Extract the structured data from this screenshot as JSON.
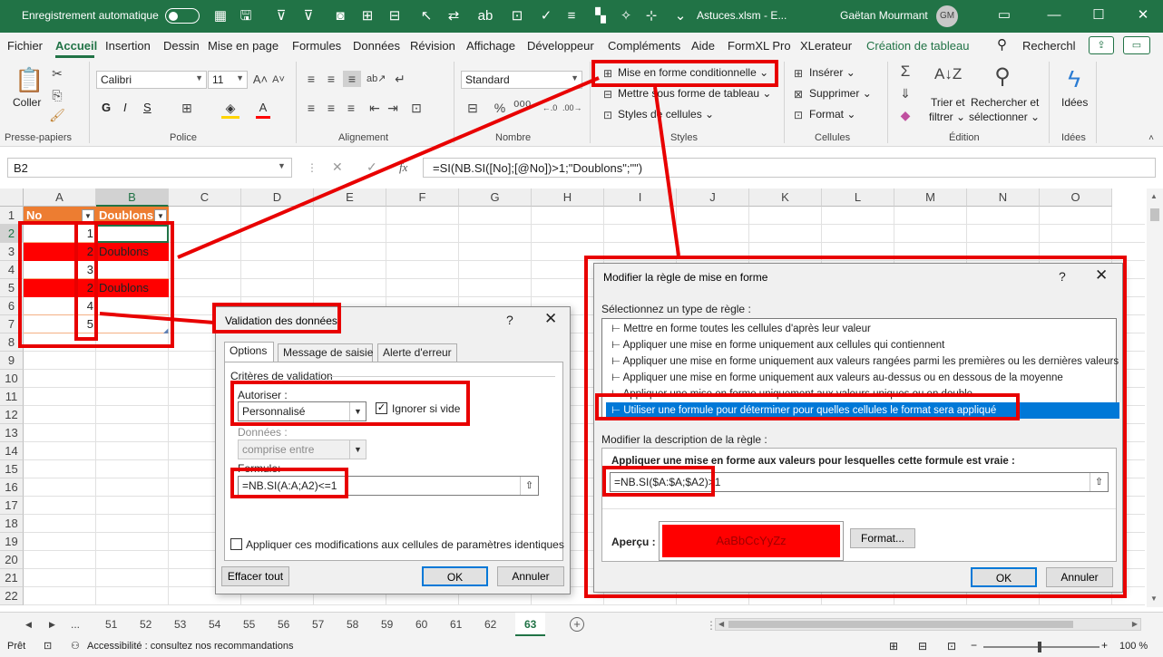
{
  "titlebar": {
    "autosave_label": "Enregistrement automatique",
    "filename": "Astuces.xlsm  -  E...",
    "user": "Gaëtan Mourmant",
    "initials": "GM"
  },
  "tabs": [
    "Fichier",
    "Accueil",
    "Insertion",
    "Dessin",
    "Mise en page",
    "Formules",
    "Données",
    "Révision",
    "Affichage",
    "Développeur",
    "Compléments",
    "Aide",
    "FormXL Pro",
    "XLerateur",
    "Création de tableau"
  ],
  "search_label": "Recherchl",
  "ribbon": {
    "coller": "Coller",
    "font_name": "Calibri",
    "font_size": "11",
    "bold": "G",
    "italic": "I",
    "underline": "S",
    "number_format": "Standard",
    "cond_format": "Mise en forme conditionnelle",
    "table_format": "Mettre sous forme de tableau",
    "cell_styles": "Styles de cellules",
    "insert": "Insérer",
    "delete": "Supprimer",
    "format": "Format",
    "sort_l1": "Trier et",
    "sort_l2": "filtrer",
    "find_l1": "Rechercher et",
    "find_l2": "sélectionner",
    "ideas": "Idées",
    "groups": [
      "Presse-papiers",
      "Police",
      "Alignement",
      "Nombre",
      "Styles",
      "Cellules",
      "Édition",
      "Idées"
    ]
  },
  "formula_bar": {
    "name_box": "B2",
    "fx": "fx",
    "formula": "=SI(NB.SI([No];[@No])>1;\"Doublons\";\"\")"
  },
  "columns": [
    "A",
    "B",
    "C",
    "D",
    "E",
    "F",
    "G",
    "H",
    "I",
    "J",
    "K",
    "L",
    "M",
    "N",
    "O"
  ],
  "rows": [
    "1",
    "2",
    "3",
    "4",
    "5",
    "6",
    "7",
    "8",
    "9",
    "10",
    "11",
    "12",
    "13",
    "14",
    "15",
    "16",
    "17",
    "18",
    "19",
    "20",
    "21",
    "22"
  ],
  "table": {
    "header_no": "No",
    "header_doublons": "Doublons",
    "values": [
      "1",
      "2",
      "3",
      "2",
      "4",
      "5"
    ],
    "flags": [
      "",
      "Doublons",
      "",
      "Doublons",
      "",
      ""
    ]
  },
  "sheet_tabs": [
    "...",
    "51",
    "52",
    "53",
    "54",
    "55",
    "56",
    "57",
    "58",
    "59",
    "60",
    "61",
    "62",
    "63"
  ],
  "status": {
    "ready": "Prêt",
    "accessibility": "Accessibilité : consultez nos recommandations",
    "zoom": "100 %"
  },
  "validation_dialog": {
    "title": "Validation des données",
    "tabs": [
      "Options",
      "Message de saisie",
      "Alerte d'erreur"
    ],
    "criteria": "Critères de validation",
    "allow_label": "Autoriser :",
    "allow_value": "Personnalisé",
    "ignore_blank": "Ignorer si vide",
    "data_label": "Données :",
    "data_value": "comprise entre",
    "formula_label": "Formule:",
    "formula_value": "=NB.SI(A:A;A2)<=1",
    "apply_all": "Appliquer ces modifications aux cellules de paramètres identiques",
    "clear": "Effacer tout",
    "ok": "OK",
    "cancel": "Annuler"
  },
  "rule_dialog": {
    "title": "Modifier la règle de mise en forme",
    "select_type": "Sélectionnez un type de règle :",
    "rule_types": [
      "Mettre en forme toutes les cellules d'après leur valeur",
      "Appliquer une mise en forme uniquement aux cellules qui contiennent",
      "Appliquer une mise en forme uniquement aux valeurs rangées parmi les premières ou les dernières valeurs",
      "Appliquer une mise en forme uniquement aux valeurs au-dessus ou en dessous de la moyenne",
      "Appliquer une mise en forme uniquement aux valeurs uniques ou en double",
      "Utiliser une formule pour déterminer pour quelles cellules le format sera appliqué"
    ],
    "edit_desc": "Modifier la description de la règle :",
    "formula_prompt": "Appliquer une mise en forme aux valeurs pour lesquelles cette formule est vraie :",
    "formula_value": "=NB.SI($A:$A;$A2)>1",
    "preview_label": "Aperçu :",
    "preview_text": "AaBbCcYyZz",
    "format_btn": "Format...",
    "ok": "OK",
    "cancel": "Annuler"
  },
  "colors": {
    "excel_green": "#217346",
    "table_header": "#ed7d31",
    "duplicate_fill": "#ff0000",
    "callout": "#e80000",
    "selection_blue": "#0078d7"
  }
}
